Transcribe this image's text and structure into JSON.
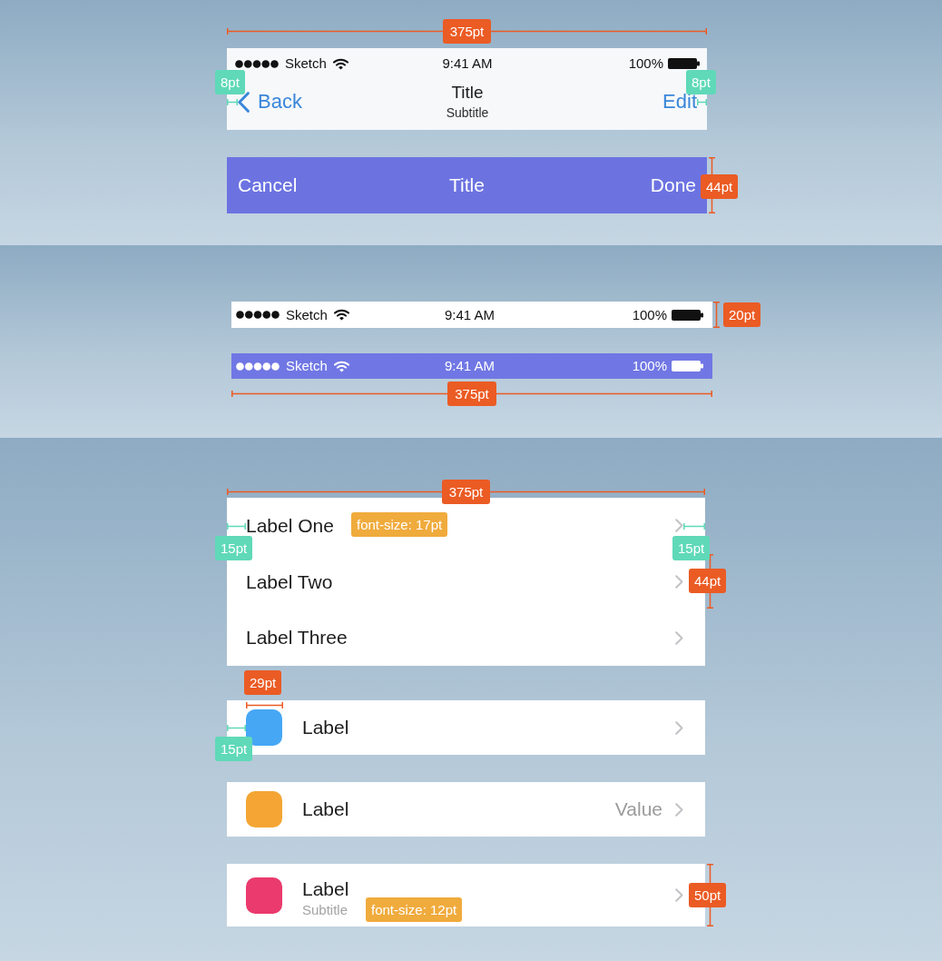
{
  "nav_section": {
    "width_annotation": {
      "kind": "dimension",
      "label": "375pt"
    },
    "nav_bar": {
      "status_bar": {
        "kind": "light",
        "carrier": "Sketch",
        "time": "9:41 AM",
        "battery": "100%"
      },
      "back_button": "Back",
      "title": "Title",
      "subtitle": "Subtitle",
      "edit_button": "Edit",
      "annotations": [
        {
          "kind": "spacing",
          "label": "8pt"
        },
        {
          "kind": "spacing",
          "label": "8pt"
        }
      ]
    },
    "modal_bar": {
      "cancel_button": "Cancel",
      "title": "Title",
      "done_button": "Done",
      "annotations": [
        {
          "kind": "dimension",
          "label": "44pt"
        }
      ]
    }
  },
  "status_section": {
    "status_bars": [
      {
        "kind": "light",
        "carrier": "Sketch",
        "time": "9:41 AM",
        "battery": "100%",
        "annotations": [
          {
            "kind": "dimension",
            "label": "20pt"
          }
        ]
      },
      {
        "kind": "tinted",
        "carrier": "Sketch",
        "time": "9:41 AM",
        "battery": "100%"
      }
    ],
    "width_annotation": {
      "kind": "dimension",
      "label": "375pt"
    }
  },
  "list_section": {
    "width_annotation": {
      "kind": "dimension",
      "label": "375pt"
    },
    "plain_list": {
      "rows": [
        {
          "label": "Label One"
        },
        {
          "label": "Label Two"
        },
        {
          "label": "Label Three"
        }
      ],
      "annotations": [
        {
          "kind": "font",
          "label": "font-size: 17pt"
        },
        {
          "kind": "spacing",
          "label": "15pt"
        },
        {
          "kind": "spacing",
          "label": "15pt"
        },
        {
          "kind": "dimension",
          "label": "44pt"
        }
      ]
    },
    "icon_list": {
      "rows": [
        {
          "label": "Label",
          "color": "#46a7f5",
          "annotations": [
            {
              "kind": "dimension",
              "label": "29pt"
            },
            {
              "kind": "spacing",
              "label": "15pt"
            }
          ]
        },
        {
          "label": "Label",
          "value": "Value",
          "color": "#f4a534"
        },
        {
          "label": "Label",
          "subtitle": "Subtitle",
          "color": "#ea3a6e",
          "annotations": [
            {
              "kind": "font",
              "label": "font-size: 12pt"
            },
            {
              "kind": "dimension",
              "label": "50pt"
            }
          ]
        }
      ]
    }
  }
}
